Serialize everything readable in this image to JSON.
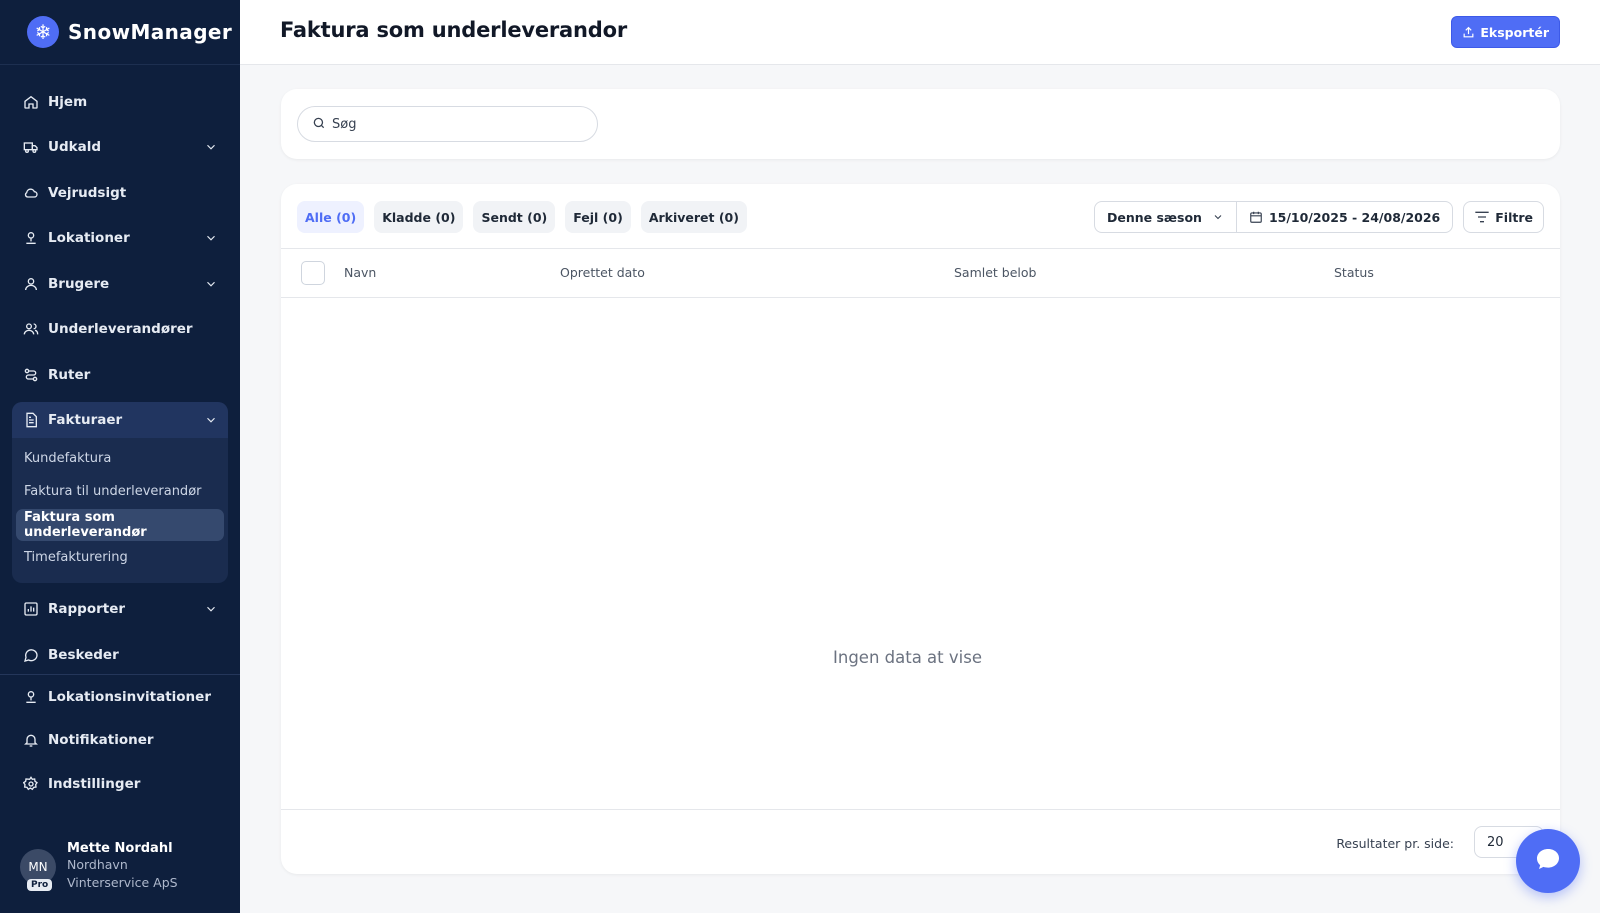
{
  "app": {
    "name": "SnowManager"
  },
  "sidebar": {
    "items": [
      {
        "label": "Hjem"
      },
      {
        "label": "Udkald"
      },
      {
        "label": "Vejrudsigt"
      },
      {
        "label": "Lokationer"
      },
      {
        "label": "Brugere"
      },
      {
        "label": "Underleverandører"
      },
      {
        "label": "Ruter"
      },
      {
        "label": "Fakturaer"
      },
      {
        "label": "Rapporter"
      },
      {
        "label": "Beskeder"
      }
    ],
    "sub_items": [
      {
        "label": "Kundefaktura"
      },
      {
        "label": "Faktura til underleverandør"
      },
      {
        "label": "Faktura som underleverandør"
      },
      {
        "label": "Timefakturering"
      }
    ],
    "bottom_items": [
      {
        "label": "Lokationsinvitationer"
      },
      {
        "label": "Notifikationer"
      },
      {
        "label": "Indstillinger"
      }
    ]
  },
  "user": {
    "initials": "MN",
    "badge": "Pro",
    "name": "Mette Nordahl",
    "org": "Nordhavn Vinterservice ApS"
  },
  "header": {
    "title": "Faktura som underleverandor",
    "export_label": "Eksportér"
  },
  "search": {
    "placeholder": "Søg"
  },
  "tabs": [
    {
      "label": "Alle (0)"
    },
    {
      "label": "Kladde (0)"
    },
    {
      "label": "Sendt (0)"
    },
    {
      "label": "Fejl (0)"
    },
    {
      "label": "Arkiveret (0)"
    }
  ],
  "filters": {
    "season": "Denne sæson",
    "date_range": "15/10/2025 - 24/08/2026",
    "filter_label": "Filtre"
  },
  "table": {
    "columns": [
      "Navn",
      "Oprettet dato",
      "Samlet belob",
      "Status"
    ],
    "empty_text": "Ingen data at vise"
  },
  "footer": {
    "per_page_label": "Resultater pr. side:",
    "per_page_value": "20"
  },
  "colors": {
    "sidebar_bg": "#0e1f3d",
    "accent": "#4f6df5"
  }
}
